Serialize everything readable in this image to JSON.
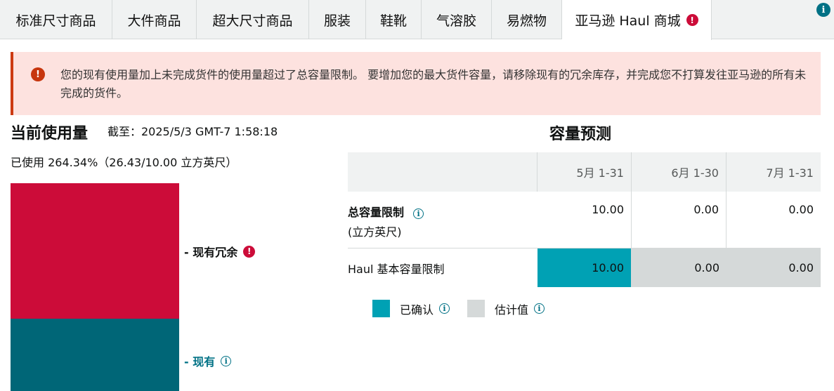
{
  "tabs": [
    {
      "label": "标准尺寸商品"
    },
    {
      "label": "大件商品"
    },
    {
      "label": "超大尺寸商品"
    },
    {
      "label": "服装"
    },
    {
      "label": "鞋靴"
    },
    {
      "label": "气溶胶"
    },
    {
      "label": "易燃物"
    },
    {
      "label": "亚马逊 Haul 商城",
      "active": true,
      "icon": "error-icon"
    }
  ],
  "alert": {
    "text": "您的现有使用量加上未完成货件的使用量超过了总容量限制。 要增加您的最大货件容量，请移除现有的冗余库存，并完成您不打算发往亚马逊的所有未完成的货件。",
    "icon": "error-icon"
  },
  "usage": {
    "title": "当前使用量",
    "as_of": "截至：2025/5/3 GMT-7 1:58:18",
    "used": "已使用 264.34%（26.43/10.00 立方英尺）",
    "excess_label": "- 现有冗余",
    "existing_label": "- 现有",
    "excess_color": "#cc0c39",
    "existing_color": "#006677"
  },
  "forecast": {
    "title": "容量预测",
    "columns": [
      "5月 1-31",
      "6月 1-30",
      "7月 1-31"
    ],
    "rows": [
      {
        "label": "总容量限制",
        "sublabel": "(立方英尺)",
        "values": [
          "10.00",
          "0.00",
          "0.00"
        ]
      },
      {
        "label": "Haul 基本容量限制",
        "values": [
          "10.00",
          "0.00",
          "0.00"
        ]
      }
    ],
    "legend": [
      {
        "label": "已确认",
        "color": "#00a1b4"
      },
      {
        "label": "估计值",
        "color": "#d5d9d9"
      }
    ]
  }
}
